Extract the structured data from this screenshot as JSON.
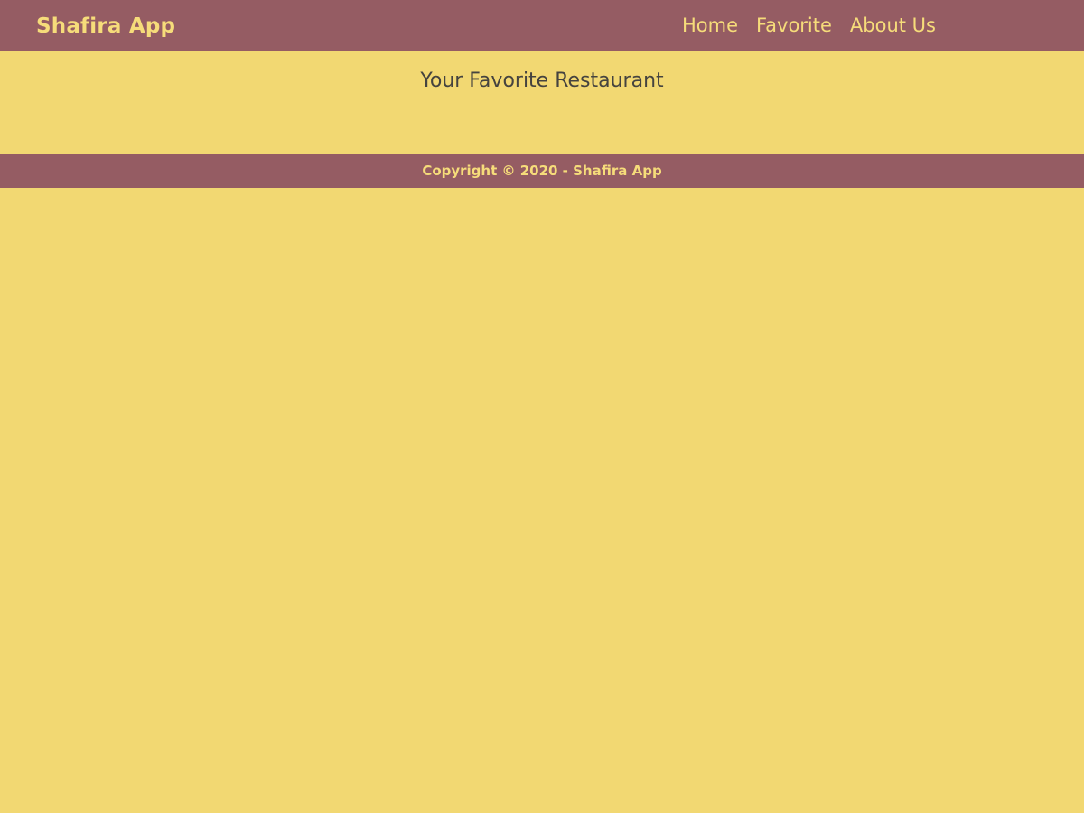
{
  "header": {
    "brand": "Shafira App",
    "nav": [
      {
        "label": "Home"
      },
      {
        "label": "Favorite"
      },
      {
        "label": "About Us"
      }
    ]
  },
  "main": {
    "title": "Your Favorite Restaurant"
  },
  "footer": {
    "text": "Copyright © 2020 - Shafira App"
  },
  "colors": {
    "background": "#F2D872",
    "bar": "#955C63",
    "bar_text": "#F6DC7A",
    "title_text": "#45433F"
  }
}
